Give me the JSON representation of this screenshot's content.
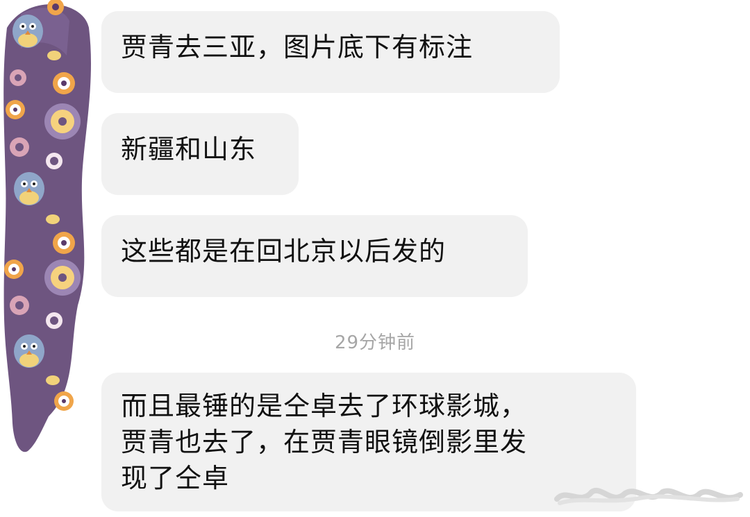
{
  "messages": [
    {
      "text": "贾青去三亚，图片底下有标注"
    },
    {
      "text": "新疆和山东"
    },
    {
      "text": "这些都是在回北京以后发的"
    },
    {
      "text": "而且最锤的是仝卓去了环球影城，\n贾青也去了，在贾青眼镜倒影里发\n现了仝卓"
    }
  ],
  "timestamp": "29分钟前",
  "colors": {
    "bubble_bg": "#f1f1f1",
    "scribble": "#6e5580",
    "timestamp": "#a6a6a6"
  },
  "icons": {
    "avatar": "owl-pattern-avatar-obscured"
  }
}
